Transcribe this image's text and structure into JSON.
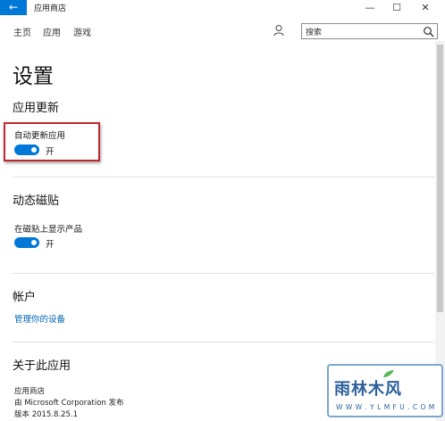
{
  "window": {
    "back_glyph": "←",
    "title": "应用商店",
    "minimize_glyph": "—",
    "maximize_glyph": "☐",
    "close_glyph": "✕"
  },
  "nav": {
    "items": [
      {
        "label": "主页"
      },
      {
        "label": "应用"
      },
      {
        "label": "游戏"
      }
    ],
    "search_value": "搜索"
  },
  "page": {
    "title": "设置"
  },
  "app_updates": {
    "heading": "应用更新",
    "setting_label": "自动更新应用",
    "toggle_state": "开",
    "toggle_on": true
  },
  "live_tile": {
    "heading": "动态磁贴",
    "setting_label": "在磁贴上显示产品",
    "toggle_state": "开",
    "toggle_on": true
  },
  "account": {
    "heading": "帐户",
    "link": "管理你的设备"
  },
  "about": {
    "heading": "关于此应用",
    "app_name": "应用商店",
    "publisher": "由 Microsoft Corporation 发布",
    "version": "版本 2015.8.25.1"
  },
  "watermark": {
    "text": "雨林木风",
    "url": "W W W . Y L M F U . C O M"
  },
  "colors": {
    "accent": "#0078d7",
    "link": "#0063b1",
    "highlight": "#c0282e"
  }
}
